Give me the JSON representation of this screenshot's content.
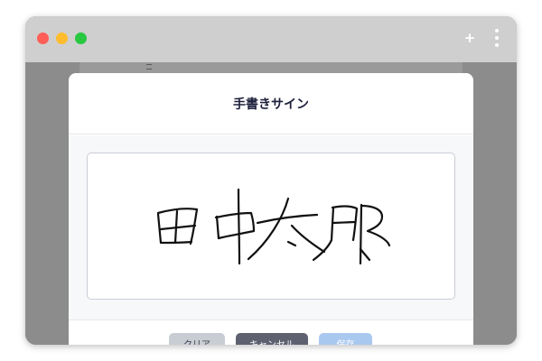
{
  "window": {
    "new_tab_label": "+"
  },
  "modal": {
    "title": "手書きサイン"
  },
  "signature": {
    "text": "田中太郎",
    "stroke_color": "#111111"
  },
  "buttons": {
    "clear_label": "クリア",
    "cancel_label": "キャンセル",
    "save_label": "保存"
  },
  "colors": {
    "titlebar": "#cfcfcf",
    "close_dot": "#ff5f57",
    "minimize_dot": "#febc2e",
    "zoom_dot": "#28c840",
    "clear_button": "#c8ccd3",
    "cancel_button": "#5d6170",
    "save_button": "#a9c8ef"
  }
}
